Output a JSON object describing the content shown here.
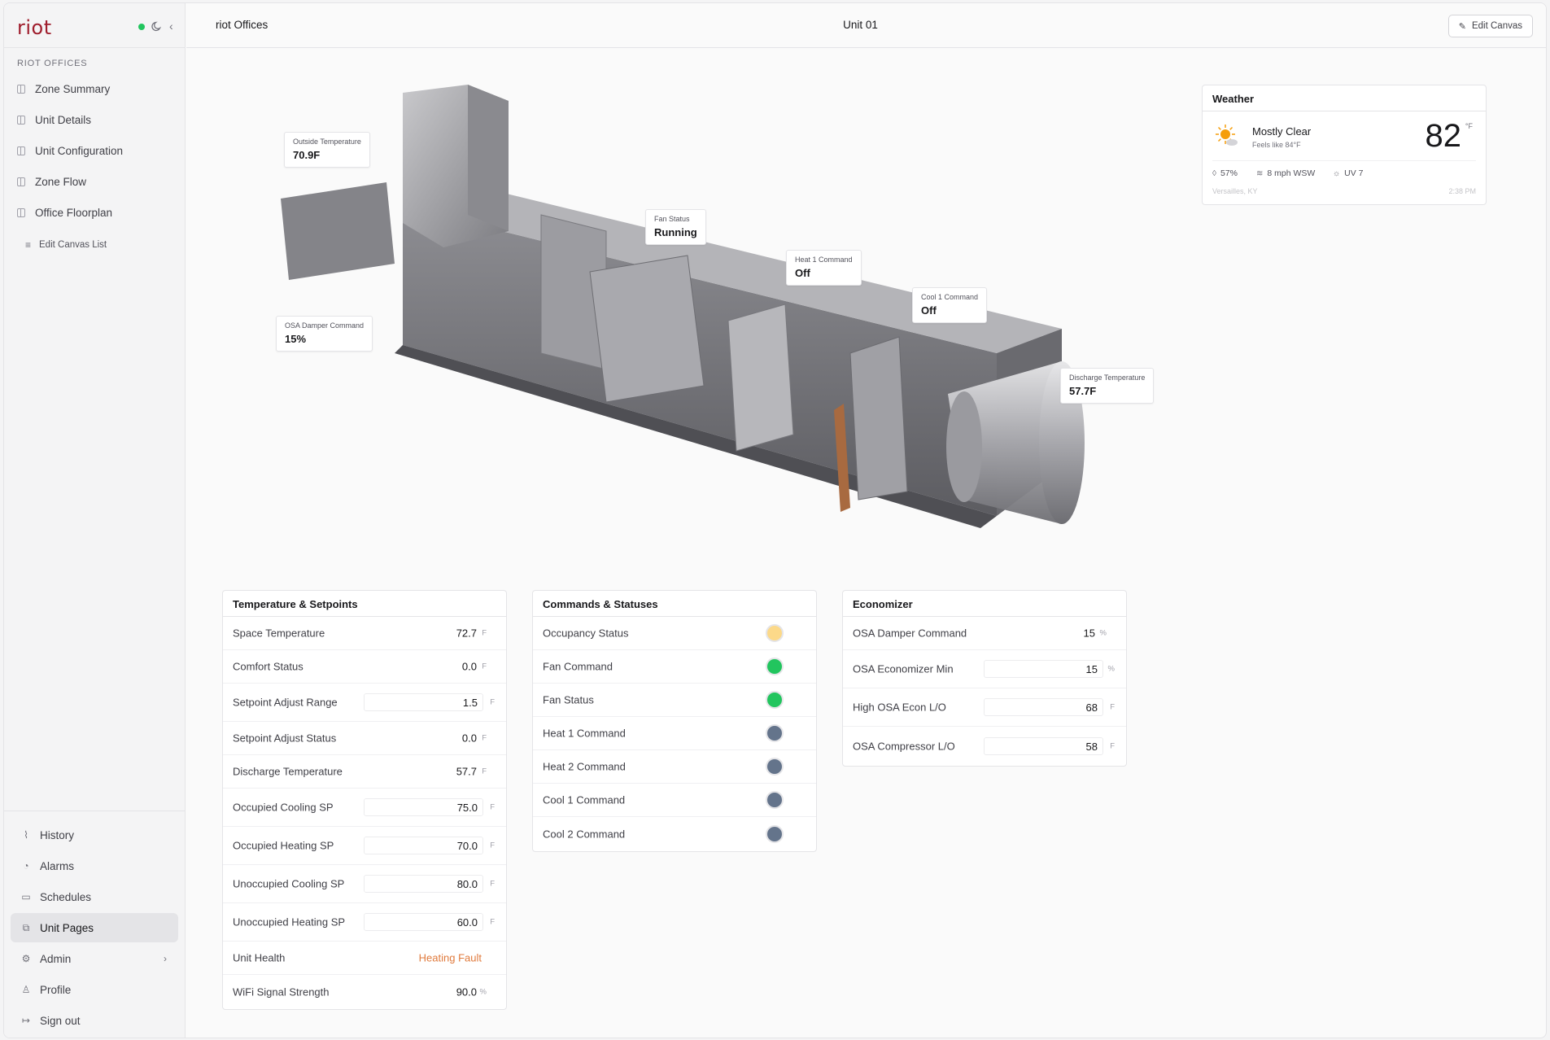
{
  "app": {
    "logo": "riot"
  },
  "sidebar": {
    "section_label": "RIOT OFFICES",
    "items": [
      {
        "label": "Zone Summary"
      },
      {
        "label": "Unit Details"
      },
      {
        "label": "Unit Configuration"
      },
      {
        "label": "Zone Flow"
      },
      {
        "label": "Office Floorplan"
      }
    ],
    "edit_list_label": "Edit Canvas List",
    "bottom_items": [
      {
        "label": "History",
        "icon": "chart-icon"
      },
      {
        "label": "Alarms",
        "icon": "bell-icon"
      },
      {
        "label": "Schedules",
        "icon": "calendar-icon"
      },
      {
        "label": "Unit Pages",
        "icon": "unit-pages-icon",
        "active": true
      },
      {
        "label": "Admin",
        "icon": "gear-icon"
      },
      {
        "label": "Profile",
        "icon": "user-icon"
      },
      {
        "label": "Sign out",
        "icon": "sign-out-icon"
      }
    ]
  },
  "header": {
    "breadcrumb": "riot Offices",
    "title": "Unit 01",
    "edit_button": "Edit Canvas"
  },
  "diagram": {
    "outside_temp": {
      "label": "Outside Temperature",
      "value": "70.9F"
    },
    "fan_status": {
      "label": "Fan Status",
      "value": "Running"
    },
    "heat1": {
      "label": "Heat 1 Command",
      "value": "Off"
    },
    "cool1": {
      "label": "Cool 1 Command",
      "value": "Off"
    },
    "osa_damper": {
      "label": "OSA Damper Command",
      "value": "15%"
    },
    "discharge": {
      "label": "Discharge Temperature",
      "value": "57.7F"
    }
  },
  "weather": {
    "title": "Weather",
    "condition": "Mostly Clear",
    "feels_like": "Feels like 84°F",
    "temp": "82",
    "unit": "°F",
    "humidity": "57%",
    "wind": "8 mph WSW",
    "uv": "UV 7",
    "location": "Versailles, KY",
    "time": "2:38 PM"
  },
  "temps_panel": {
    "title": "Temperature & Setpoints",
    "rows": [
      {
        "label": "Space Temperature",
        "value": "72.7",
        "unit": "F"
      },
      {
        "label": "Comfort Status",
        "value": "0.0",
        "unit": "F"
      },
      {
        "label": "Setpoint Adjust Range",
        "value": "1.5",
        "unit": "F"
      },
      {
        "label": "Setpoint Adjust Status",
        "value": "0.0",
        "unit": "F"
      },
      {
        "label": "Discharge Temperature",
        "value": "57.7",
        "unit": "F"
      },
      {
        "label": "Occupied Cooling SP",
        "value": "75.0",
        "unit": "F"
      },
      {
        "label": "Occupied Heating SP",
        "value": "70.0",
        "unit": "F"
      },
      {
        "label": "Unoccupied Cooling SP",
        "value": "80.0",
        "unit": "F"
      },
      {
        "label": "Unoccupied Heating SP",
        "value": "60.0",
        "unit": "F"
      },
      {
        "label": "Unit Health",
        "value": "Heating Fault"
      },
      {
        "label": "WiFi Signal Strength",
        "value": "90.0",
        "unit": "%"
      }
    ]
  },
  "commands_panel": {
    "title": "Commands & Statuses",
    "rows": [
      {
        "label": "Occupancy Status",
        "color": "#fcd989"
      },
      {
        "label": "Fan Command",
        "color": "#22c55e"
      },
      {
        "label": "Fan Status",
        "color": "#22c55e"
      },
      {
        "label": "Heat 1 Command",
        "color": "#64748b"
      },
      {
        "label": "Heat 2 Command",
        "color": "#64748b"
      },
      {
        "label": "Cool 1 Command",
        "color": "#64748b"
      },
      {
        "label": "Cool 2 Command",
        "color": "#64748b"
      }
    ]
  },
  "econ_panel": {
    "title": "Economizer",
    "rows": [
      {
        "label": "OSA Damper Command",
        "value": "15",
        "unit": "%"
      },
      {
        "label": "OSA Economizer Min",
        "value": "15",
        "unit": "%"
      },
      {
        "label": "High OSA Econ L/O",
        "value": "68",
        "unit": "F"
      },
      {
        "label": "OSA Compressor L/O",
        "value": "58",
        "unit": "F"
      }
    ]
  },
  "colors": {
    "brand": "#9f1d2c",
    "online": "#22c55e",
    "fault": "#e07a3c"
  }
}
